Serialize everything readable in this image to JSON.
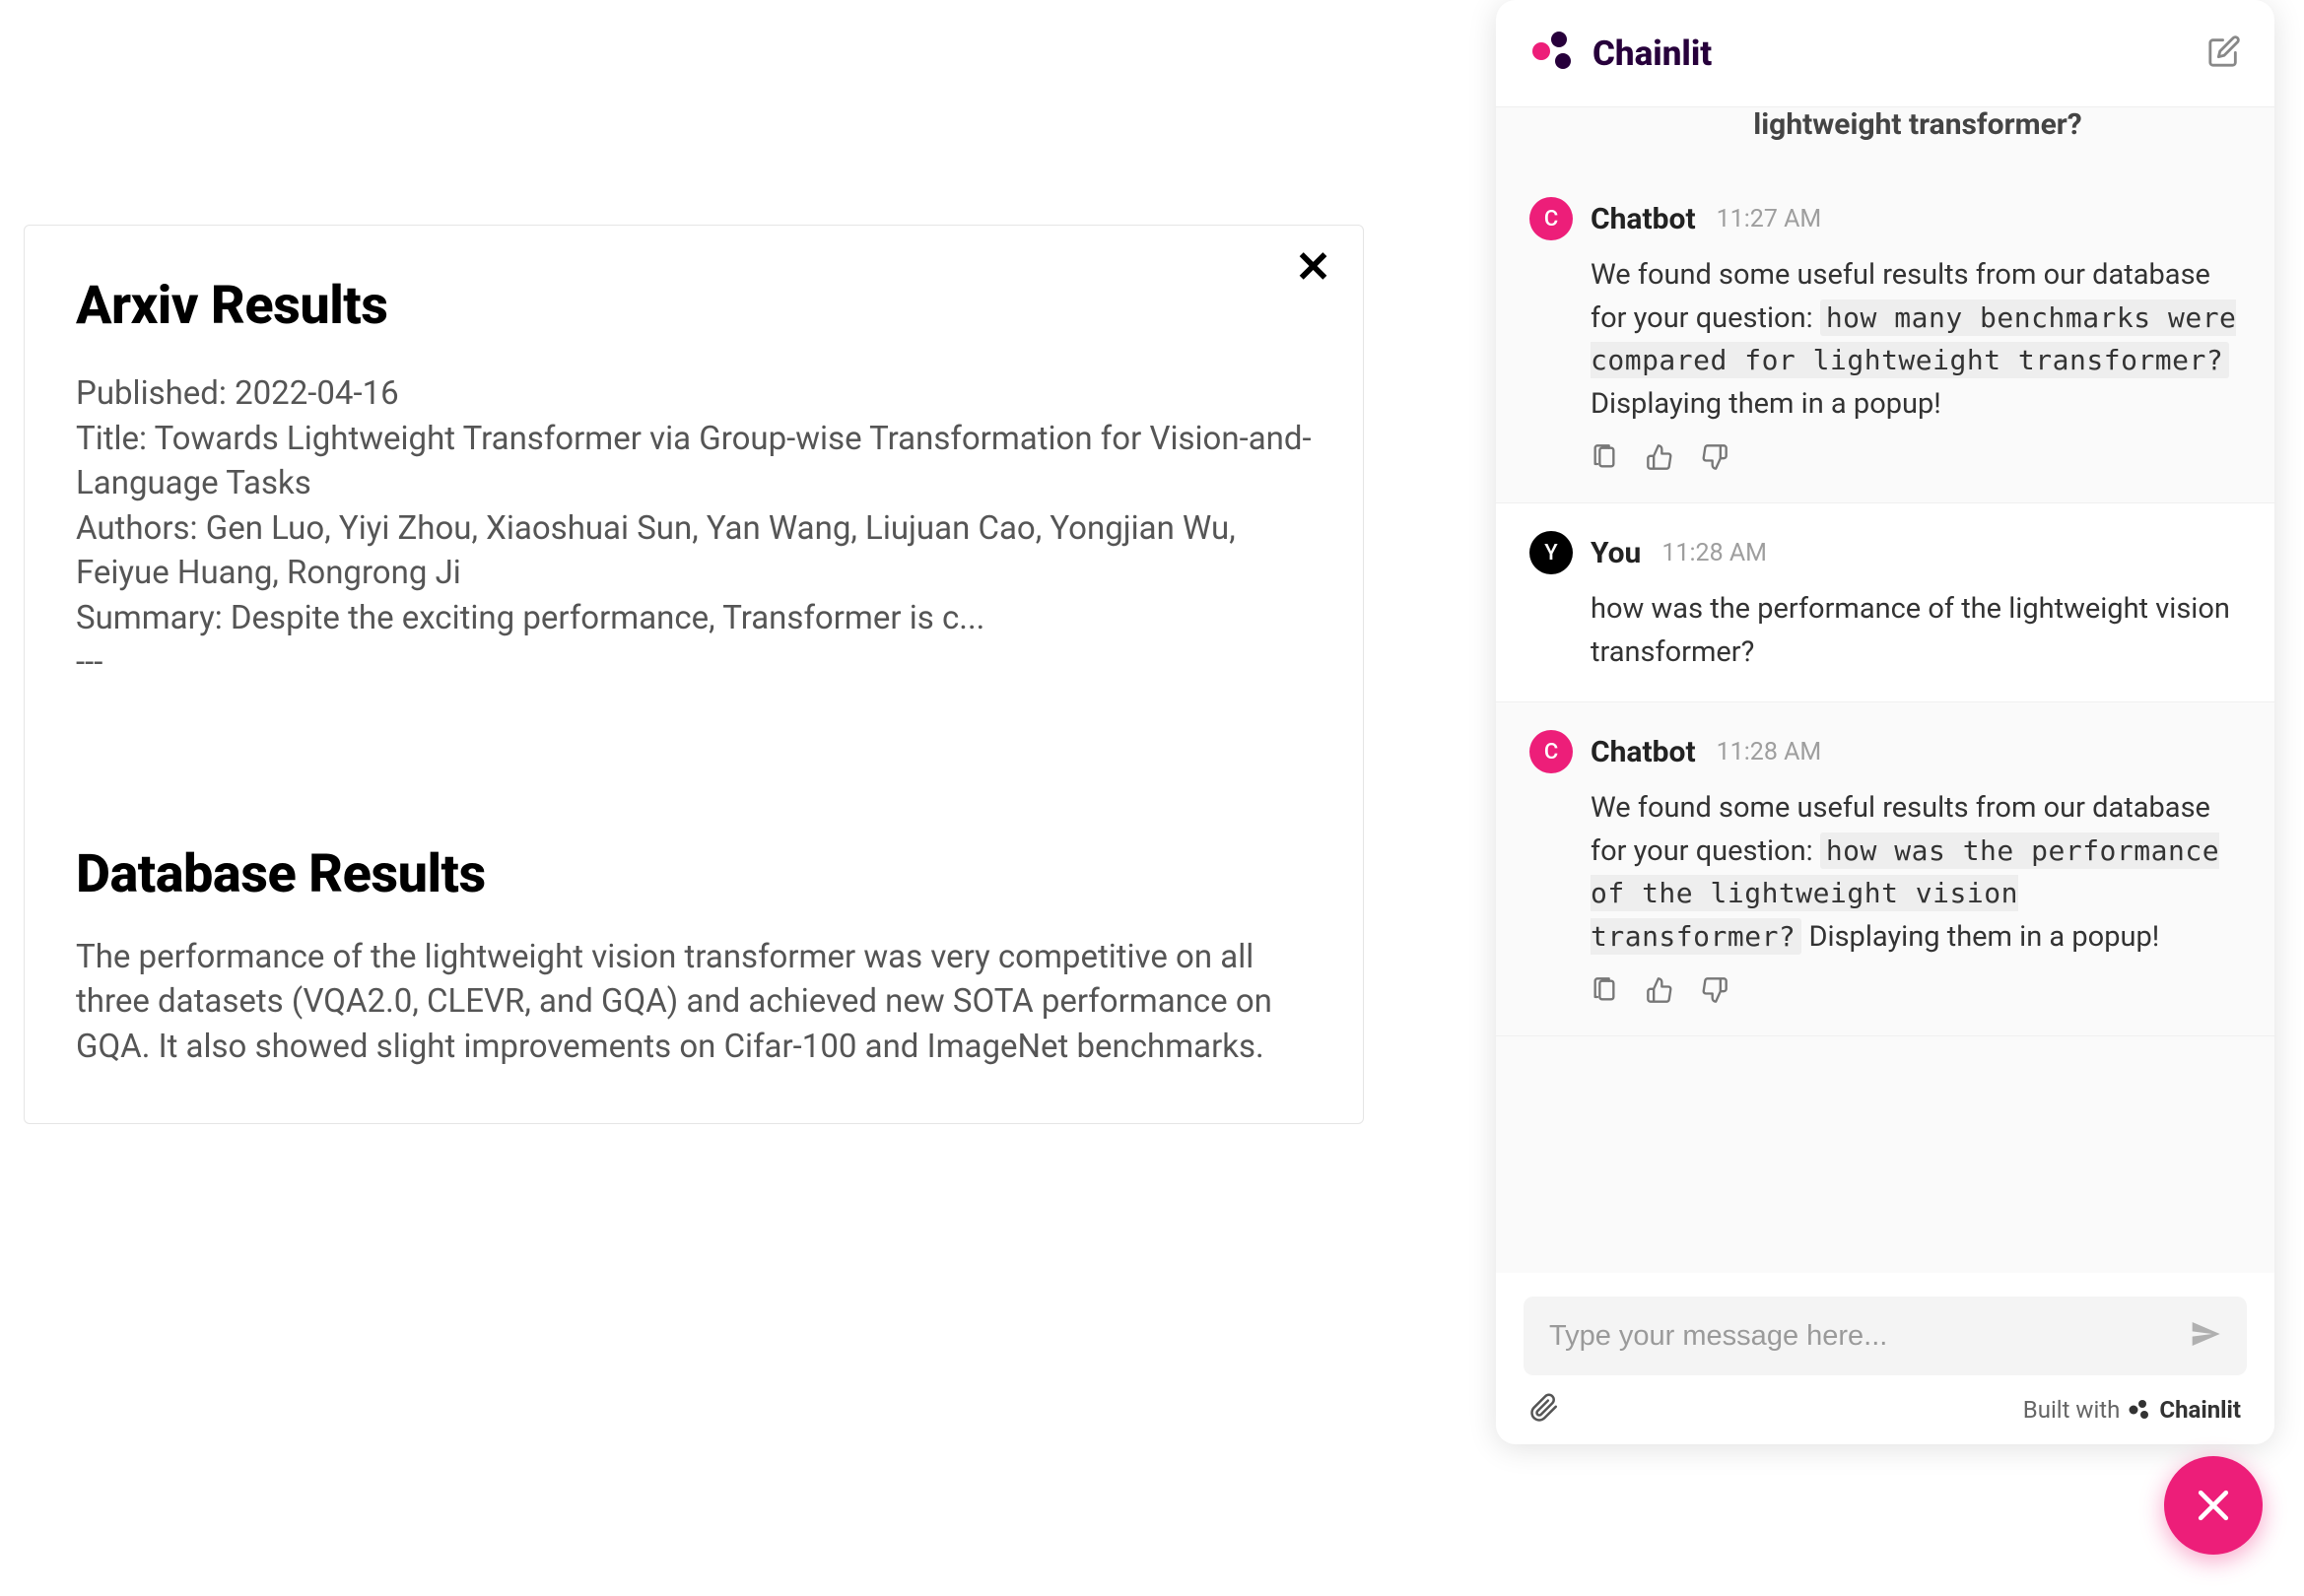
{
  "results": {
    "arxiv_heading": "Arxiv Results",
    "arxiv_published": "Published: 2022-04-16",
    "arxiv_title": "Title: Towards Lightweight Transformer via Group-wise Transformation for Vision-and-Language Tasks",
    "arxiv_authors": "Authors: Gen Luo, Yiyi Zhou, Xiaoshuai Sun, Yan Wang, Liujuan Cao, Yongjian Wu, Feiyue Huang, Rongrong Ji",
    "arxiv_summary": "Summary: Despite the exciting performance, Transformer is c...",
    "arxiv_sep": "---",
    "db_heading": "Database Results",
    "db_body": "The performance of the lightweight vision transformer was very competitive on all three datasets (VQA2.0, CLEVR, and GQA) and achieved new SOTA performance on GQA. It also showed slight improvements on Cifar-100 and ImageNet benchmarks."
  },
  "chat": {
    "brand": "Chainlit",
    "partial_top": "lightweight transformer?",
    "messages": [
      {
        "role": "bot",
        "avatar": "C",
        "name": "Chatbot",
        "time": "11:27 AM",
        "prefix": "We found some useful results from our database for your question: ",
        "code": "how many benchmarks were compared for lightweight transformer?",
        "suffix": " Displaying them in a popup!"
      },
      {
        "role": "user",
        "avatar": "Y",
        "name": "You",
        "time": "11:28 AM",
        "text": "how was the performance of the lightweight vision transformer?"
      },
      {
        "role": "bot",
        "avatar": "C",
        "name": "Chatbot",
        "time": "11:28 AM",
        "prefix": "We found some useful results from our database for your question: ",
        "code": "how was the performance of the lightweight vision transformer?",
        "suffix": " Displaying them in a popup!"
      }
    ],
    "input_placeholder": "Type your message here...",
    "built_with_label": "Built with",
    "built_with_name": "Chainlit"
  }
}
